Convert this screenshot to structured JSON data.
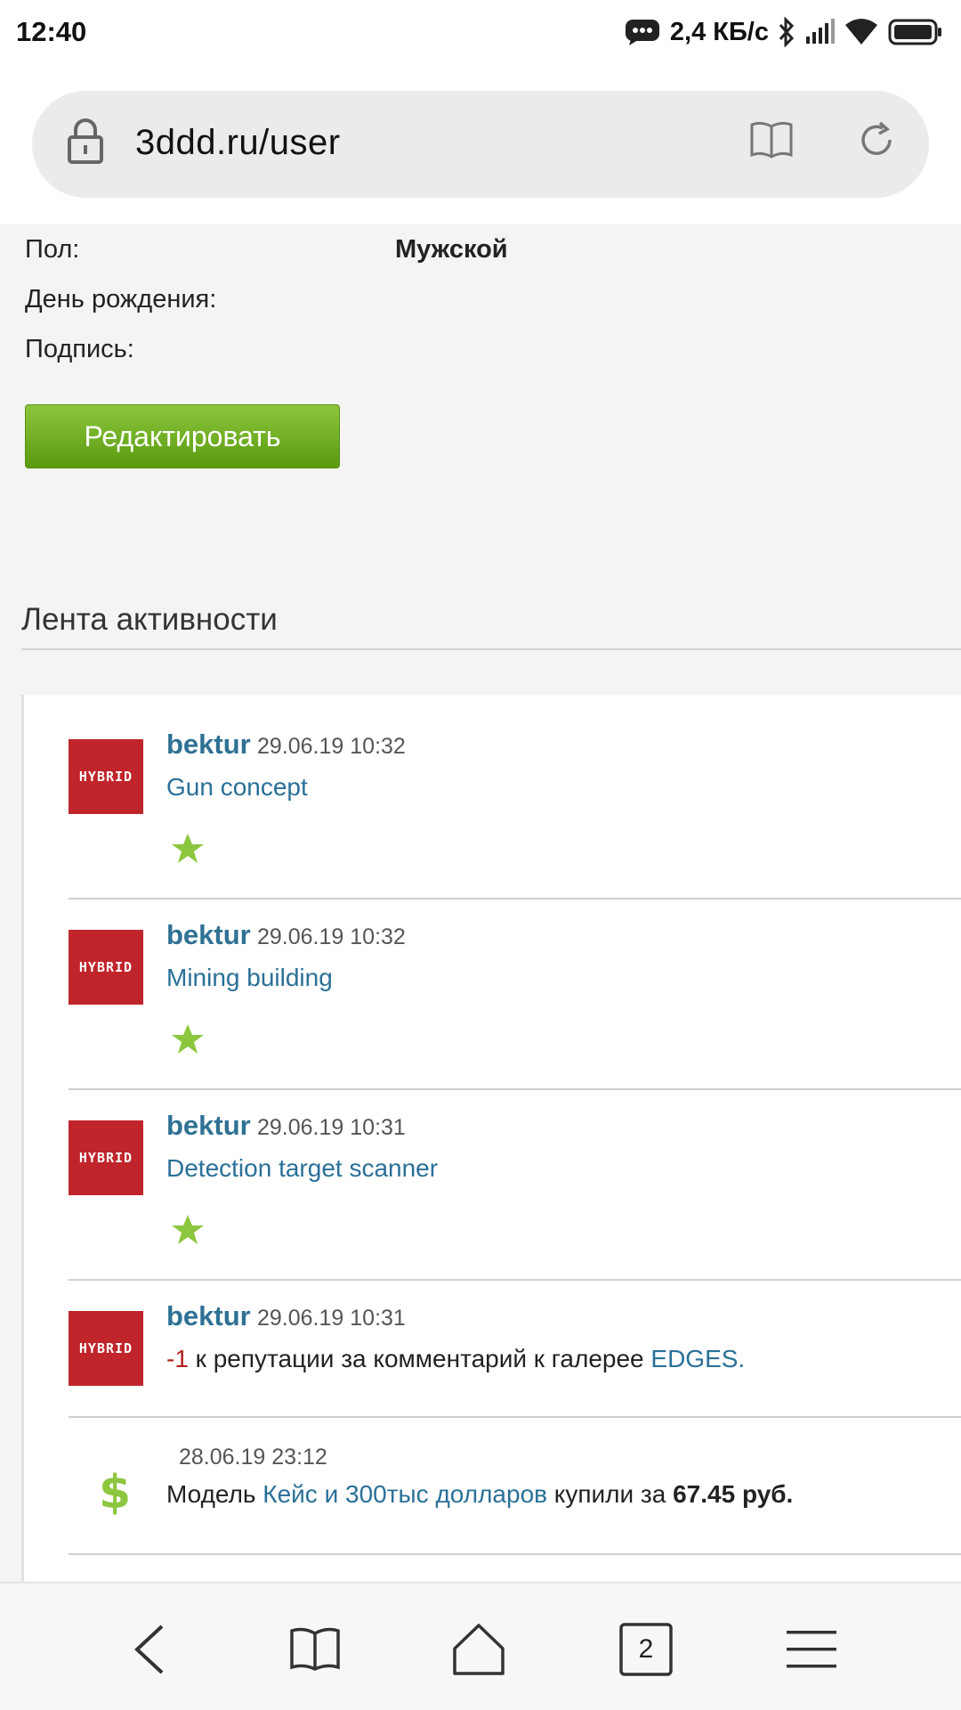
{
  "status_bar": {
    "time": "12:40",
    "speed": "2,4 КБ/с",
    "icons": [
      "chat-icon",
      "bluetooth-icon",
      "signal-icon",
      "wifi-icon",
      "battery-icon"
    ]
  },
  "browser": {
    "url": "3ddd.ru/user",
    "icons": [
      "lock-icon",
      "reader-mode-icon",
      "reload-icon"
    ]
  },
  "profile": {
    "gender_label": "Пол:",
    "gender_value": "Мужской",
    "birthday_label": "День рождения:",
    "signature_label": "Подпись:",
    "edit_button": "Редактировать"
  },
  "activity": {
    "title": "Лента активности",
    "items": [
      {
        "author": "bektur",
        "date": "29.06.19 10:32",
        "link": "Gun concept",
        "avatar_text": "HYBRID"
      },
      {
        "author": "bektur",
        "date": "29.06.19 10:32",
        "link": "Mining building",
        "avatar_text": "HYBRID"
      },
      {
        "author": "bektur",
        "date": "29.06.19 10:31",
        "link": "Detection target scanner",
        "avatar_text": "HYBRID"
      },
      {
        "author": "bektur",
        "date": "29.06.19 10:31",
        "avatar_text": "HYBRID",
        "rep_value": "-1",
        "rep_text": " к репутации за комментарий к галерее ",
        "rep_link": "EDGES."
      },
      {
        "date": "28.06.19 23:12",
        "icon": "dollar-icon",
        "prefix": "Модель ",
        "model_link": "Кейс и 300тыс долларов",
        "middle": " купили за ",
        "price": "67.45 руб."
      }
    ]
  },
  "nav": {
    "tabs_count": "2",
    "icons": [
      "back-icon",
      "bookmarks-icon",
      "home-icon",
      "tabs-icon",
      "menu-icon"
    ]
  },
  "colors": {
    "accent_green": "#8cc63e",
    "link_blue": "#2a7098",
    "author_blue": "#2f7194",
    "avatar_red": "#c0252c",
    "negative_red": "#b0231c"
  }
}
